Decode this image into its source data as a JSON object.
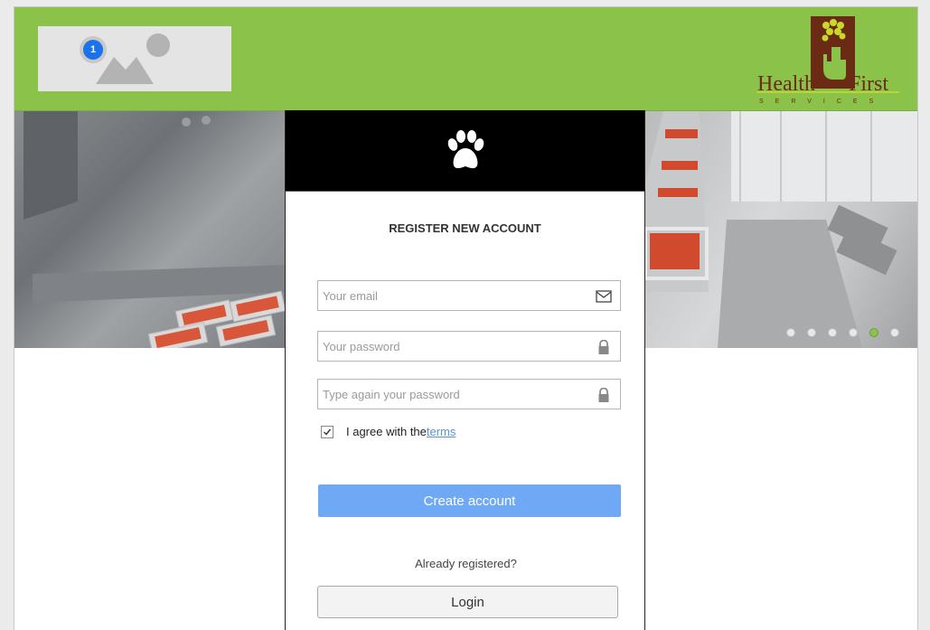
{
  "header": {
    "image_badge": "1",
    "logo": {
      "line1": "Health",
      "line2": "First",
      "tagline": "SERVICES"
    }
  },
  "banner": {
    "slides_count": 6,
    "active_slide": 5
  },
  "form": {
    "icon": "paw-icon",
    "title": "REGISTER NEW ACCOUNT",
    "email_placeholder": "Your email",
    "password_placeholder": "Your password",
    "confirm_placeholder": "Type again your password",
    "agree_text": "I agree with the",
    "terms_link": "terms",
    "agree_checked": true,
    "create_button": "Create account",
    "already_text": "Already registered?",
    "login_button": "Login"
  },
  "colors": {
    "header_bg": "#8bc34a",
    "primary_button": "#6fa8f5",
    "logo_brown": "#6b2a14"
  }
}
